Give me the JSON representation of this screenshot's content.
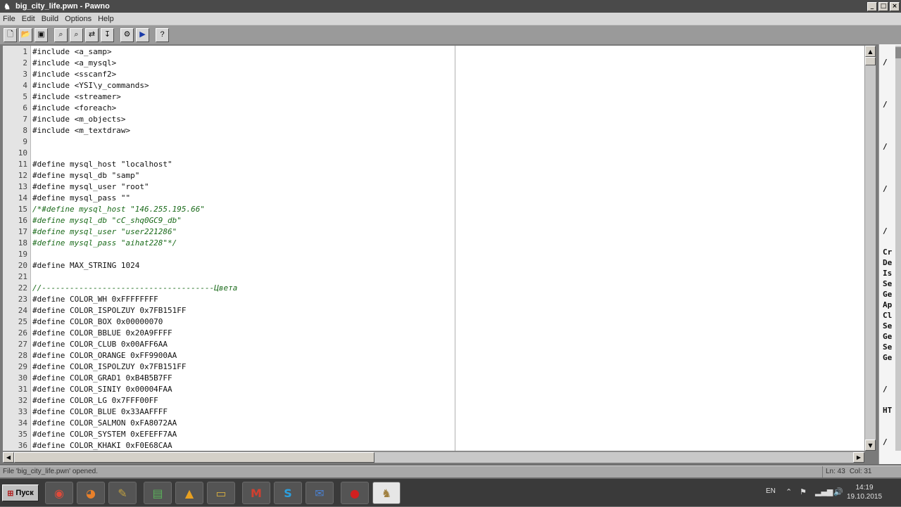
{
  "window": {
    "title": "big_city_life.pwn - Pawno",
    "minimize": "_",
    "maximize": "□",
    "close": "×"
  },
  "menu": [
    "File",
    "Edit",
    "Build",
    "Options",
    "Help"
  ],
  "toolbar": {
    "buttons": [
      "new-file",
      "open-file",
      "save-file",
      "find",
      "find-next",
      "replace",
      "goto-line",
      "compile",
      "run",
      "help"
    ]
  },
  "editor": {
    "lines": [
      {
        "n": "1",
        "text": "#include <a_samp>"
      },
      {
        "n": "2",
        "text": "#include <a_mysql>"
      },
      {
        "n": "3",
        "text": "#include <sscanf2>"
      },
      {
        "n": "4",
        "text": "#include <YSI\\y_commands>"
      },
      {
        "n": "5",
        "text": "#include <streamer>"
      },
      {
        "n": "6",
        "text": "#include <foreach>"
      },
      {
        "n": "7",
        "text": "#include <m_objects>"
      },
      {
        "n": "8",
        "text": "#include <m_textdraw>"
      },
      {
        "n": "9",
        "text": ""
      },
      {
        "n": "10",
        "text": ""
      },
      {
        "n": "11",
        "text": "#define mysql_host \"localhost\""
      },
      {
        "n": "12",
        "text": "#define mysql_db \"samp\""
      },
      {
        "n": "13",
        "text": "#define mysql_user \"root\""
      },
      {
        "n": "14",
        "text": "#define mysql_pass \"\""
      },
      {
        "n": "15",
        "text": "/*#define mysql_host \"146.255.195.66\"",
        "comment": true
      },
      {
        "n": "16",
        "text": "#define mysql_db \"cC_shq0GC9_db\"",
        "comment": true
      },
      {
        "n": "17",
        "text": "#define mysql_user \"user221286\"",
        "comment": true
      },
      {
        "n": "18",
        "text": "#define mysql_pass \"aihat228\"*/",
        "comment": true
      },
      {
        "n": "19",
        "text": ""
      },
      {
        "n": "20",
        "text": "#define MAX_STRING 1024"
      },
      {
        "n": "21",
        "text": ""
      },
      {
        "n": "22",
        "text": "//-------------------------------------Цвета",
        "comment": true
      },
      {
        "n": "23",
        "text": "#define COLOR_WH 0xFFFFFFFF"
      },
      {
        "n": "24",
        "text": "#define COLOR_ISPOLZUY 0x7FB151FF"
      },
      {
        "n": "25",
        "text": "#define COLOR_BOX 0x00000070"
      },
      {
        "n": "26",
        "text": "#define COLOR_BBLUE 0x20A9FFFF"
      },
      {
        "n": "27",
        "text": "#define COLOR_CLUB 0x00AFF6AA"
      },
      {
        "n": "28",
        "text": "#define COLOR_ORANGE 0xFF9900AA"
      },
      {
        "n": "29",
        "text": "#define COLOR_ISPOLZUY 0x7FB151FF"
      },
      {
        "n": "30",
        "text": "#define COLOR_GRAD1 0xB4B5B7FF"
      },
      {
        "n": "31",
        "text": "#define COLOR_SINIY 0x00004FAA"
      },
      {
        "n": "32",
        "text": "#define COLOR_LG 0x7FFF00FF"
      },
      {
        "n": "33",
        "text": "#define COLOR_BLUE 0x33AAFFFF"
      },
      {
        "n": "34",
        "text": "#define COLOR_SALMON 0xFA8072AA"
      },
      {
        "n": "35",
        "text": "#define COLOR_SYSTEM 0xEFEFF7AA"
      },
      {
        "n": "36",
        "text": "#define COLOR_KHAKI 0xF0E68CAA"
      }
    ],
    "colors": {
      "comment": "#1a6a1a",
      "text": "#111111",
      "background": "#ffffff"
    }
  },
  "side_panel": {
    "entries": [
      "/",
      "/",
      "/",
      "/",
      "/",
      "Cr",
      "De",
      "Is",
      "Se",
      "Ge",
      "Ap",
      "Cl",
      "Se",
      "Ge",
      "Se",
      "Ge",
      "/",
      "HT",
      "/"
    ]
  },
  "status": {
    "message": "File 'big_city_life.pwn' opened.",
    "line": "Ln: 43",
    "col": "Col: 31"
  },
  "taskbar": {
    "start_label": "Пуск",
    "apps": [
      "chrome",
      "firefox",
      "paint",
      "terminal",
      "avast",
      "explorer",
      "media-center",
      "skype",
      "messenger",
      "opera",
      "pawno"
    ],
    "language": "EN",
    "time": "14:19",
    "date": "19.10.2015"
  }
}
